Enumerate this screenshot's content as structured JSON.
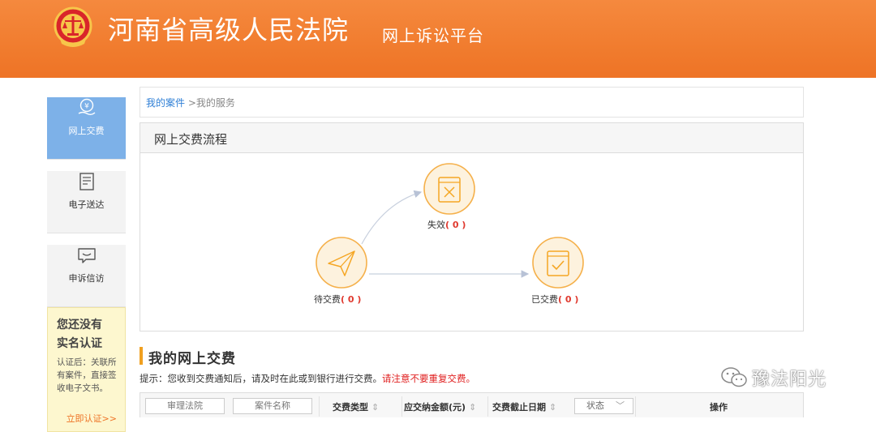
{
  "header": {
    "title": "河南省高级人民法院",
    "subtitle": "网上诉讼平台"
  },
  "sidebar": {
    "items": [
      {
        "label": "网上交费",
        "icon": "yen-hand-icon"
      },
      {
        "label": "电子送达",
        "icon": "document-icon"
      },
      {
        "label": "申诉信访",
        "icon": "chat-bubble-icon"
      }
    ],
    "cert": {
      "title_line1": "您还没有",
      "title_line2": "实名认证",
      "desc": "认证后：关联所有案件，直接签收电子文书。",
      "link": "立即认证>>"
    }
  },
  "breadcrumb": {
    "link": "我的案件",
    "sep": " >",
    "current": "我的服务"
  },
  "flow": {
    "title": "网上交费流程",
    "nodes": {
      "pending": {
        "label": "待交费",
        "count": "( 0 )"
      },
      "invalid": {
        "label": "失效",
        "count": "( 0 )"
      },
      "paid": {
        "label": "已交费",
        "count": "( 0 )"
      }
    }
  },
  "section": {
    "title": "我的网上交费"
  },
  "tip": {
    "text": "提示：您收到交费通知后，请及时在此或到银行进行交费。",
    "warn": "请注意不要重复交费。"
  },
  "table": {
    "court_placeholder": "审理法院",
    "case_placeholder": "案件名称",
    "fee_type": "交费类型",
    "amount": "应交纳金额(元)",
    "deadline": "交费截止日期",
    "status": "状态",
    "operation": "操作",
    "sort_arrow": "⇕"
  },
  "watermark": {
    "text": "豫法阳光"
  },
  "colors": {
    "header_orange": "#f07a2c",
    "active_blue": "#7db1e8",
    "node_orange": "#f5a623",
    "warn_red": "#e02020",
    "link_blue": "#2f7fd6"
  }
}
